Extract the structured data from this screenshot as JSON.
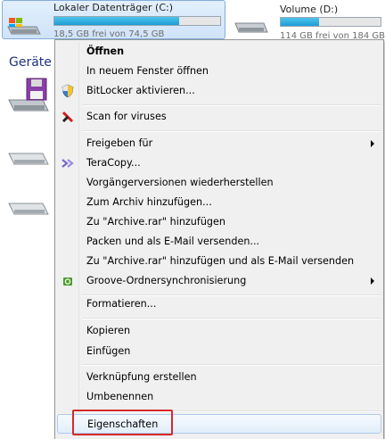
{
  "drives": [
    {
      "name": "Lokaler Datenträger (C:)",
      "free_text": "18,5 GB frei von 74,5 GB",
      "used_fraction": 0.75,
      "selected": true
    },
    {
      "name": "Volume (D:)",
      "free_text": "114 GB frei von 184 GB",
      "used_fraction": 0.38,
      "selected": false
    }
  ],
  "section_title": "Geräte m",
  "context_menu": {
    "items": [
      {
        "label": "Öffnen",
        "bold": true,
        "icon": null,
        "submenu": false
      },
      {
        "label": "In neuem Fenster öffnen",
        "icon": null,
        "submenu": false
      },
      {
        "label": "BitLocker aktivieren...",
        "icon": "bitlocker-shield-icon",
        "submenu": false
      },
      {
        "label": "Scan for viruses",
        "icon": "antivirus-icon",
        "submenu": false
      },
      {
        "label": "Freigeben für",
        "icon": null,
        "submenu": true
      },
      {
        "label": "TeraCopy...",
        "icon": "teracopy-icon",
        "submenu": false
      },
      {
        "label": "Vorgängerversionen wiederherstellen",
        "icon": null,
        "submenu": false
      },
      {
        "label": "Zum Archiv hinzufügen...",
        "icon": null,
        "submenu": false
      },
      {
        "label": "Zu \"Archive.rar\" hinzufügen",
        "icon": null,
        "submenu": false
      },
      {
        "label": "Packen und als E-Mail versenden...",
        "icon": null,
        "submenu": false
      },
      {
        "label": "Zu \"Archive.rar\" hinzufügen und als E-Mail versenden",
        "icon": null,
        "submenu": false
      },
      {
        "label": "Groove-Ordnersynchronisierung",
        "icon": "groove-icon",
        "submenu": true
      },
      {
        "label": "Formatieren...",
        "icon": null,
        "submenu": false
      },
      {
        "label": "Kopieren",
        "icon": null,
        "submenu": false
      },
      {
        "label": "Einfügen",
        "icon": null,
        "submenu": false
      },
      {
        "label": "Verknüpfung erstellen",
        "icon": null,
        "submenu": false
      },
      {
        "label": "Umbenennen",
        "icon": null,
        "submenu": false
      },
      {
        "label": "Eigenschaften",
        "icon": null,
        "submenu": false,
        "highlighted": true
      }
    ]
  },
  "colors": {
    "highlight_border": "#d42a2a",
    "menu_background": "#f0f0f0",
    "capacity_fill": "#1e9cd6",
    "selection_background": "#cfe3f9"
  }
}
